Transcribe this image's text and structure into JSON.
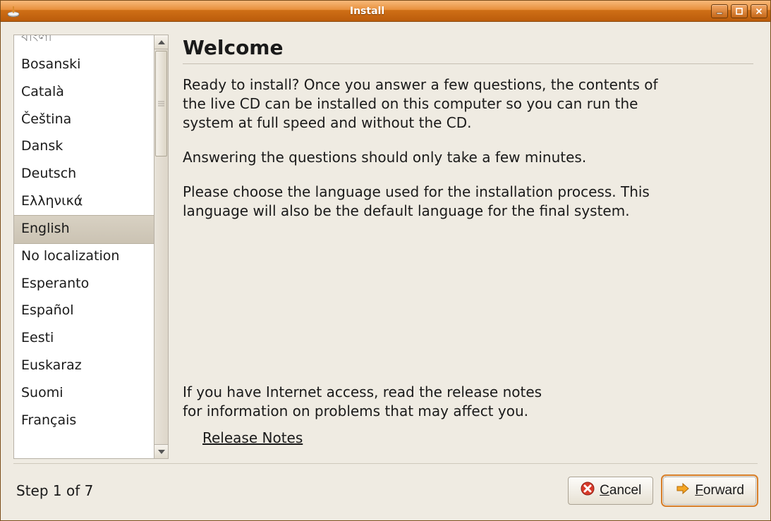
{
  "window": {
    "title": "Install"
  },
  "languages": {
    "items": [
      "বাংলা",
      "Bosanski",
      "Català",
      "Čeština",
      "Dansk",
      "Deutsch",
      "Ελληνικά",
      "English",
      "No localization",
      "Esperanto",
      "Español",
      "Eesti",
      "Euskaraz",
      "Suomi",
      "Français"
    ],
    "selected_index": 7
  },
  "main": {
    "heading": "Welcome",
    "p1": "Ready to install? Once you answer a few questions, the contents of the live CD can be installed on this computer so you can run the system at full speed and without the CD.",
    "p2": "Answering the questions should only take a few minutes.",
    "p3": "Please choose the language used for the installation process. This language will also be the default language for the final system.",
    "p4": "If you have Internet access, read the release notes for information on problems that may affect you.",
    "release_notes_label": "Release Notes"
  },
  "footer": {
    "step_label": "Step 1 of 7",
    "cancel_label": "Cancel",
    "forward_label": "Forward"
  }
}
